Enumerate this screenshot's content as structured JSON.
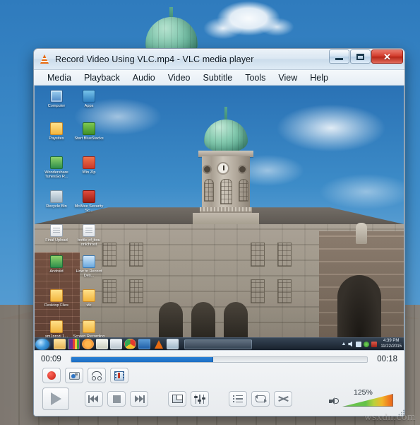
{
  "window": {
    "title": "Record Video Using VLC.mp4 - VLC media player",
    "app_icon": "vlc-cone-icon",
    "buttons": {
      "minimize": "–",
      "maximize": "□",
      "close": "✕"
    }
  },
  "menubar": {
    "items": [
      {
        "label": "Media"
      },
      {
        "label": "Playback"
      },
      {
        "label": "Audio"
      },
      {
        "label": "Video"
      },
      {
        "label": "Subtitle"
      },
      {
        "label": "Tools"
      },
      {
        "label": "View"
      },
      {
        "label": "Help"
      }
    ]
  },
  "video": {
    "desktop_icons": [
      {
        "label": "Computer",
        "icon": "computer-icon"
      },
      {
        "label": "Apps",
        "icon": "apps-shortcut-icon"
      },
      {
        "label": "Paysites",
        "icon": "folder-icon"
      },
      {
        "label": "Start BlueStacks",
        "icon": "bluestacks-icon"
      },
      {
        "label": "Wondershare TunesGo R...",
        "icon": "tunesgo-icon"
      },
      {
        "label": "Win Zip",
        "icon": "winzip-icon"
      },
      {
        "label": "Recycle Bin",
        "icon": "recycle-bin-icon"
      },
      {
        "label": "McAfee Security Sc...",
        "icon": "mcafee-shield-icon"
      },
      {
        "label": "Final Upload",
        "icon": "text-document-icon"
      },
      {
        "label": "bottle of jbou onlchrost",
        "icon": "text-document-icon"
      },
      {
        "label": "Android",
        "icon": "android-icon"
      },
      {
        "label": "How to Record Des...",
        "icon": "document-shortcut-icon"
      },
      {
        "label": "Desktop Files",
        "icon": "folder-icon"
      },
      {
        "label": "vlc",
        "icon": "folder-icon"
      },
      {
        "label": "sm1prozi 1...",
        "icon": "folder-icon"
      },
      {
        "label": "Screen Recording",
        "icon": "folder-icon"
      }
    ],
    "taskbar": {
      "start": "start-orb",
      "apps": [
        {
          "name": "windows-explorer-icon"
        },
        {
          "name": "colorful-app-icon"
        },
        {
          "name": "media-player-icon"
        },
        {
          "name": "notepad-icon"
        },
        {
          "name": "monitor-app-icon"
        },
        {
          "name": "google-chrome-icon"
        },
        {
          "name": "word-icon"
        },
        {
          "name": "vlc-icon"
        },
        {
          "name": "paint-icon"
        }
      ],
      "tray": [
        {
          "name": "show-hidden-icons-arrow"
        },
        {
          "name": "volume-icon"
        },
        {
          "name": "network-icon"
        },
        {
          "name": "antivirus-icon"
        },
        {
          "name": "notification-icon"
        }
      ],
      "clock_time": "4:39 PM",
      "clock_date": "11/22/2015"
    }
  },
  "controls": {
    "elapsed": "00:09",
    "total": "00:18",
    "progress_percent": 48,
    "progress_color": "#2a7fd4",
    "advanced": [
      {
        "name": "record-button",
        "icon": "record-icon"
      },
      {
        "name": "snapshot-button",
        "icon": "camera-icon"
      },
      {
        "name": "ab-loop-button",
        "icon": "ab-loop-icon"
      },
      {
        "name": "frame-by-frame-button",
        "icon": "frame-icon"
      }
    ],
    "transport": [
      {
        "name": "play-button",
        "icon": "play-icon"
      },
      {
        "name": "previous-button",
        "icon": "previous-icon"
      },
      {
        "name": "stop-button",
        "icon": "stop-icon"
      },
      {
        "name": "next-button",
        "icon": "next-icon"
      },
      {
        "name": "fullscreen-button",
        "icon": "fullscreen-icon"
      },
      {
        "name": "extended-settings-button",
        "icon": "equalizer-icon"
      },
      {
        "name": "playlist-button",
        "icon": "playlist-icon"
      },
      {
        "name": "loop-button",
        "icon": "loop-icon"
      },
      {
        "name": "shuffle-button",
        "icon": "shuffle-icon"
      }
    ],
    "volume": {
      "label": "125%",
      "percent": 125,
      "icon": "speaker-icon"
    }
  },
  "watermark": "wsxdn.com"
}
